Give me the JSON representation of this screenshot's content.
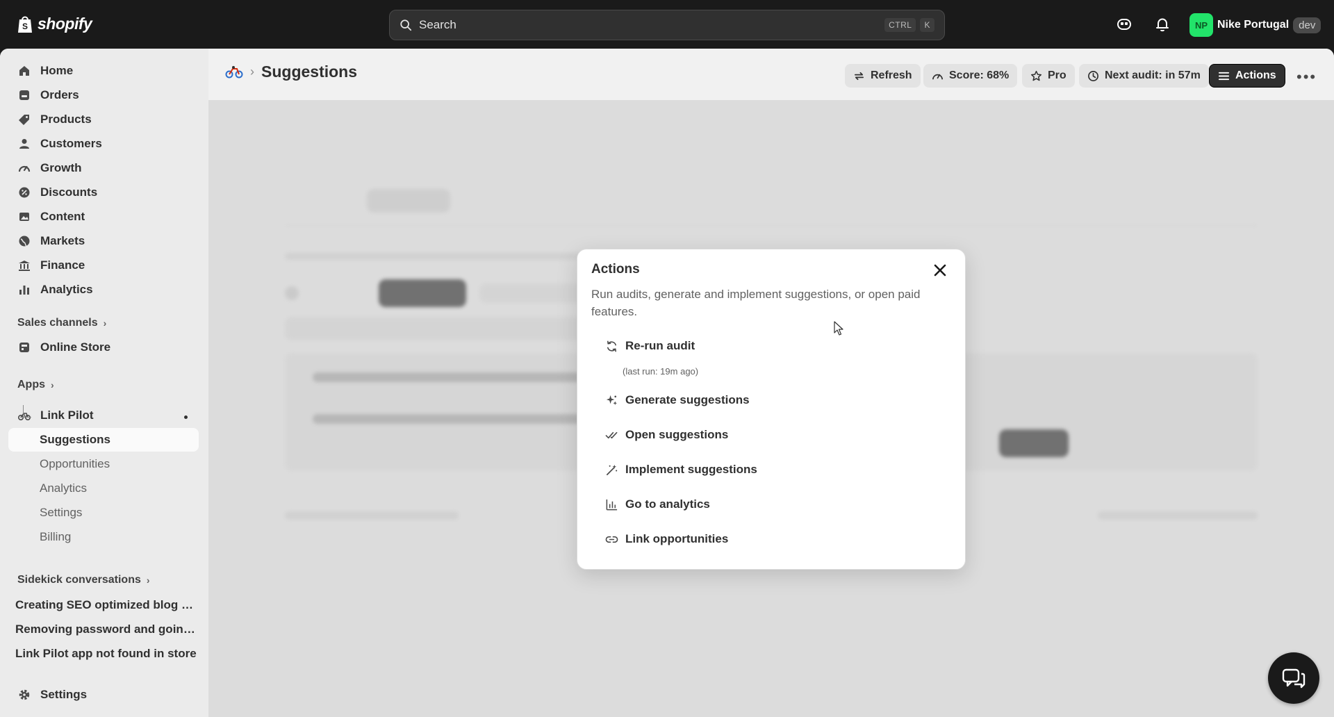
{
  "topbar": {
    "logo_text": "shopify",
    "search_placeholder": "Search",
    "shortcut_keys": [
      "CTRL",
      "K"
    ],
    "user": {
      "initials": "NP",
      "name": "Nike Portugal",
      "badge": "dev"
    }
  },
  "sidebar": {
    "nav": [
      "Home",
      "Orders",
      "Products",
      "Customers",
      "Growth",
      "Discounts",
      "Content",
      "Markets",
      "Finance",
      "Analytics"
    ],
    "sales_channels_label": "Sales channels",
    "online_store_label": "Online Store",
    "apps_label": "Apps",
    "app_name": "Link Pilot",
    "app_subitems": [
      "Suggestions",
      "Opportunities",
      "Analytics",
      "Settings",
      "Billing"
    ],
    "sidekick_label": "Sidekick conversations",
    "conversations": [
      "Creating SEO optimized blog p...",
      "Removing password and going...",
      "Link Pilot app not found in store"
    ],
    "settings_label": "Settings"
  },
  "header": {
    "title": "Suggestions",
    "buttons": {
      "refresh": "Refresh",
      "score": "Score: 68%",
      "pro": "Pro",
      "next_audit": "Next audit: in 57m",
      "actions": "Actions"
    }
  },
  "modal": {
    "title": "Actions",
    "description": "Run audits, generate and implement suggestions, or open paid features.",
    "rerun_label": "Re-run audit",
    "rerun_sub": "(last run: 19m ago)",
    "items": [
      "Generate suggestions",
      "Open suggestions",
      "Implement suggestions",
      "Go to analytics",
      "Link opportunities"
    ]
  },
  "colors": {
    "brand_green": "#22e36a",
    "dark": "#1a1a1a",
    "primary_button": "#303030"
  }
}
